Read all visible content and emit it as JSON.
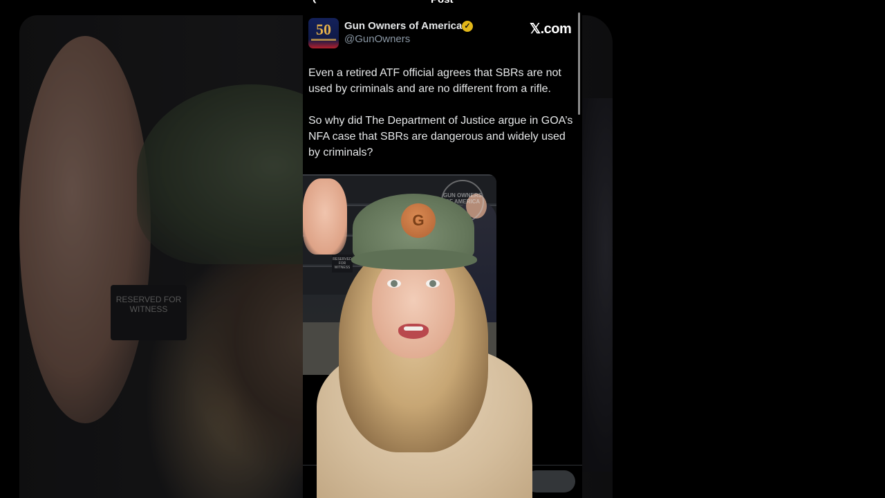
{
  "header": {
    "back_icon": "arrow-left-icon",
    "title": "Post"
  },
  "tweet": {
    "author_name": "Gun Owners of America",
    "verified_icon": "verified-badge-icon",
    "verified_color": "#e2b719",
    "handle": "@GunOwners",
    "avatar_text": "50",
    "source_logo": "𝕏.com",
    "paragraphs": [
      "Even a retired ATF official agrees that SBRs are not used by criminals and are no different from a rifle.",
      "So why did The Department of Justice argue in GOA’s NFA case that SBRs are dangerous and widely used by criminals?"
    ]
  },
  "media": {
    "watermark": "GUN OWNERS OF AMERICA",
    "seat_sign": "RESERVED FOR WITNESS",
    "patch_letter": "G"
  },
  "background": {
    "sign_text": "RESERVED FOR WITNESS"
  },
  "colors": {
    "background": "#000000",
    "text": "#e7e9ea",
    "secondary_text": "#8b98a5",
    "accent_gold": "#e2b719"
  }
}
